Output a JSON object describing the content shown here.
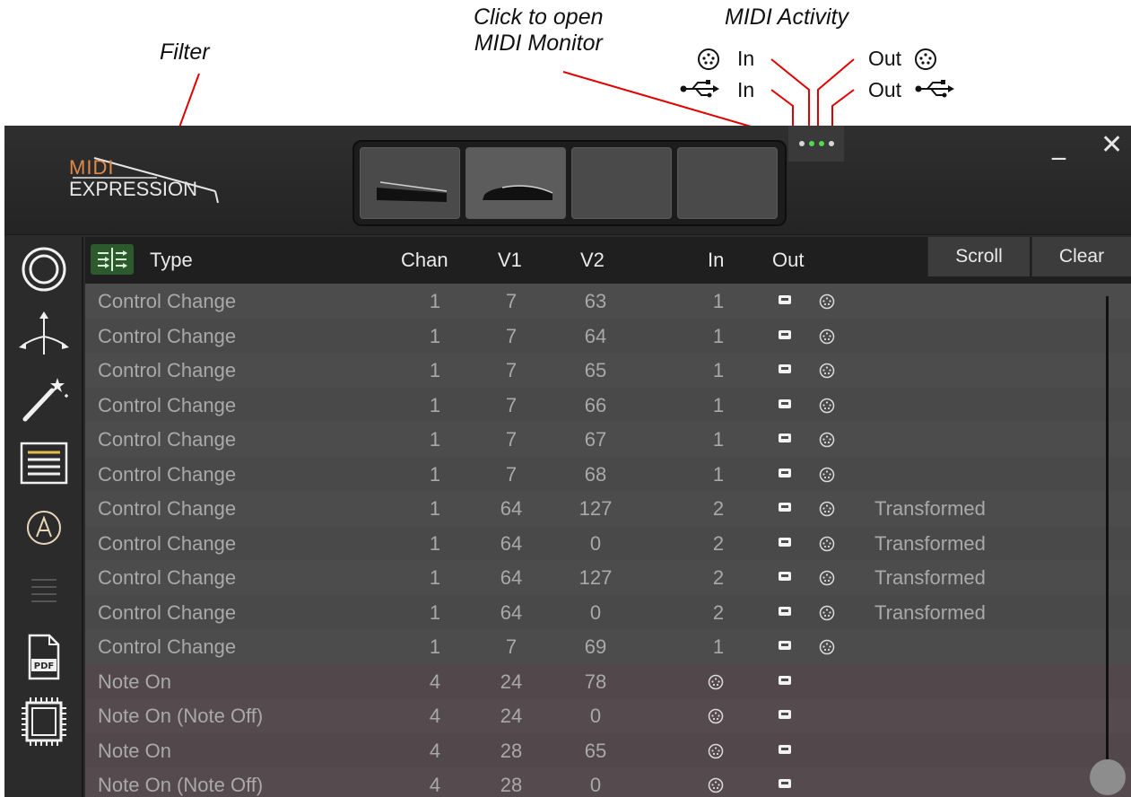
{
  "annotations": {
    "filter": "Filter",
    "open_monitor_line1": "Click to open",
    "open_monitor_line2": "MIDI Monitor",
    "midi_activity": "MIDI Activity",
    "din_in": "In",
    "din_out": "Out",
    "usb_in": "In",
    "usb_out": "Out"
  },
  "logo": {
    "line1": "MIDI",
    "line2": "EXPRESSION"
  },
  "window": {
    "minimize": "_",
    "close": "✕"
  },
  "header": {
    "type": "Type",
    "chan": "Chan",
    "v1": "V1",
    "v2": "V2",
    "in": "In",
    "out": "Out",
    "scroll": "Scroll",
    "clear": "Clear"
  },
  "sidebar": [
    "record-icon",
    "routing-icon",
    "magic-wand-icon",
    "monitor-list-icon",
    "autopilot-icon",
    "menu-lines-icon",
    "pdf-icon",
    "chip-icon"
  ],
  "activity_leds": [
    "off",
    "on",
    "on",
    "off"
  ],
  "rows": [
    {
      "type": "Control Change",
      "chan": "1",
      "v1": "7",
      "v2": "63",
      "in": "1",
      "out": [
        "usb",
        "din"
      ],
      "note": ""
    },
    {
      "type": "Control Change",
      "chan": "1",
      "v1": "7",
      "v2": "64",
      "in": "1",
      "out": [
        "usb",
        "din"
      ],
      "note": ""
    },
    {
      "type": "Control Change",
      "chan": "1",
      "v1": "7",
      "v2": "65",
      "in": "1",
      "out": [
        "usb",
        "din"
      ],
      "note": ""
    },
    {
      "type": "Control Change",
      "chan": "1",
      "v1": "7",
      "v2": "66",
      "in": "1",
      "out": [
        "usb",
        "din"
      ],
      "note": ""
    },
    {
      "type": "Control Change",
      "chan": "1",
      "v1": "7",
      "v2": "67",
      "in": "1",
      "out": [
        "usb",
        "din"
      ],
      "note": ""
    },
    {
      "type": "Control Change",
      "chan": "1",
      "v1": "7",
      "v2": "68",
      "in": "1",
      "out": [
        "usb",
        "din"
      ],
      "note": ""
    },
    {
      "type": "Control Change",
      "chan": "1",
      "v1": "64",
      "v2": "127",
      "in": "2",
      "out": [
        "usb",
        "din"
      ],
      "note": "Transformed"
    },
    {
      "type": "Control Change",
      "chan": "1",
      "v1": "64",
      "v2": "0",
      "in": "2",
      "out": [
        "usb",
        "din"
      ],
      "note": "Transformed"
    },
    {
      "type": "Control Change",
      "chan": "1",
      "v1": "64",
      "v2": "127",
      "in": "2",
      "out": [
        "usb",
        "din"
      ],
      "note": "Transformed"
    },
    {
      "type": "Control Change",
      "chan": "1",
      "v1": "64",
      "v2": "0",
      "in": "2",
      "out": [
        "usb",
        "din"
      ],
      "note": "Transformed"
    },
    {
      "type": "Control Change",
      "chan": "1",
      "v1": "7",
      "v2": "69",
      "in": "1",
      "out": [
        "usb",
        "din"
      ],
      "note": ""
    },
    {
      "type": "Note On",
      "chan": "4",
      "v1": "24",
      "v2": "78",
      "in": "din",
      "out": [
        "usb"
      ],
      "note": ""
    },
    {
      "type": "Note On (Note Off)",
      "chan": "4",
      "v1": "24",
      "v2": "0",
      "in": "din",
      "out": [
        "usb"
      ],
      "note": ""
    },
    {
      "type": "Note On",
      "chan": "4",
      "v1": "28",
      "v2": "65",
      "in": "din",
      "out": [
        "usb"
      ],
      "note": ""
    },
    {
      "type": "Note On (Note Off)",
      "chan": "4",
      "v1": "28",
      "v2": "0",
      "in": "din",
      "out": [
        "usb"
      ],
      "note": ""
    }
  ]
}
